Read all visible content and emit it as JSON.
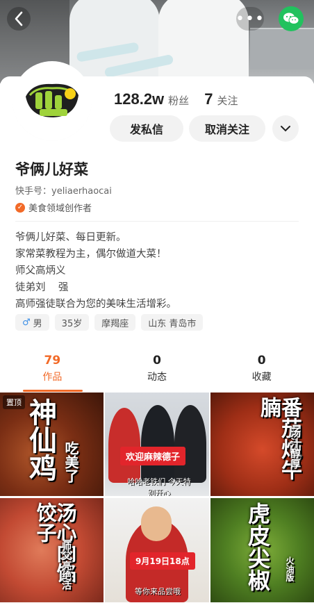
{
  "header": {
    "back_icon": "chevron-left-icon",
    "more_icon": "more-dots-icon",
    "share_icon": "wechat-icon",
    "more_label": "•••"
  },
  "profile": {
    "followers_count": "128.2w",
    "followers_label": "粉丝",
    "following_count": "7",
    "following_label": "关注",
    "message_button": "发私信",
    "unfollow_button": "取消关注",
    "name": "爷俩儿好菜",
    "kuaishou_id": "快手号：yeliaerhaocai",
    "creator_badge": "美食领域创作者",
    "bio_lines": [
      "爷俩儿好菜、每日更新。",
      "家常菜教程为主，偶尔做道大菜！",
      "师父高炳义",
      "徒弟刘    强",
      "高师强徒联合为您的美味生活增彩。"
    ],
    "tags": {
      "gender": "男",
      "age": "35岁",
      "zodiac": "摩羯座",
      "location": "山东 青岛市"
    },
    "accent_color": "#f26a28"
  },
  "tabs": [
    {
      "count": "79",
      "label": "作品"
    },
    {
      "count": "0",
      "label": "动态"
    },
    {
      "count": "0",
      "label": "收藏"
    }
  ],
  "videos": {
    "pinned_label": "置顶",
    "v1": {
      "title": "神仙鸡",
      "subtitle": "吃美了"
    },
    "v2": {
      "banner": "欢迎麻辣德子",
      "caption": "哈哈老铁们 今天特别开心"
    },
    "v3": {
      "title": "番茄炖牛腩",
      "subtitle": "汤汁醇厚"
    },
    "v4": {
      "title": "汤心肉馅饺子",
      "subtitle": "师父亮绝活"
    },
    "v5": {
      "banner": "9月19日18点",
      "caption": "等你来品尝哦"
    },
    "v6": {
      "title": "虎皮尖椒",
      "subtitle": "火油版"
    }
  }
}
